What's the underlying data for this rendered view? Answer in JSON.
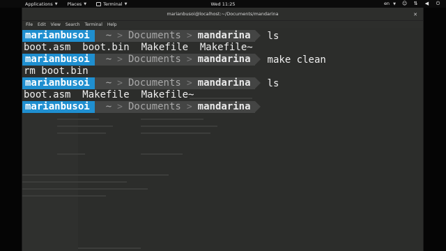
{
  "topbar": {
    "applications": "Applications",
    "places": "Places",
    "terminal": "Terminal",
    "clock": "Wed 11:25",
    "lang": "en"
  },
  "window": {
    "title": "marianbusoi@localhost:~/Documents/mandarina",
    "menu": [
      "File",
      "Edit",
      "View",
      "Search",
      "Terminal",
      "Help"
    ]
  },
  "terminal": {
    "prompt": {
      "user": "marianbusoi",
      "home": "~",
      "dir1": "Documents",
      "cwd": "mandarina",
      "sep": ">"
    },
    "commands": [
      "ls",
      "make clean",
      "ls",
      ""
    ],
    "outputs": [
      "boot.asm  boot.bin  Makefile  Makefile~",
      "rm boot.bin",
      "boot.asm  Makefile  Makefile~"
    ]
  },
  "colors": {
    "user_segment": "#1f8fd0",
    "path_segment": "#444544",
    "terminal_bg": "#2c2d2b"
  }
}
